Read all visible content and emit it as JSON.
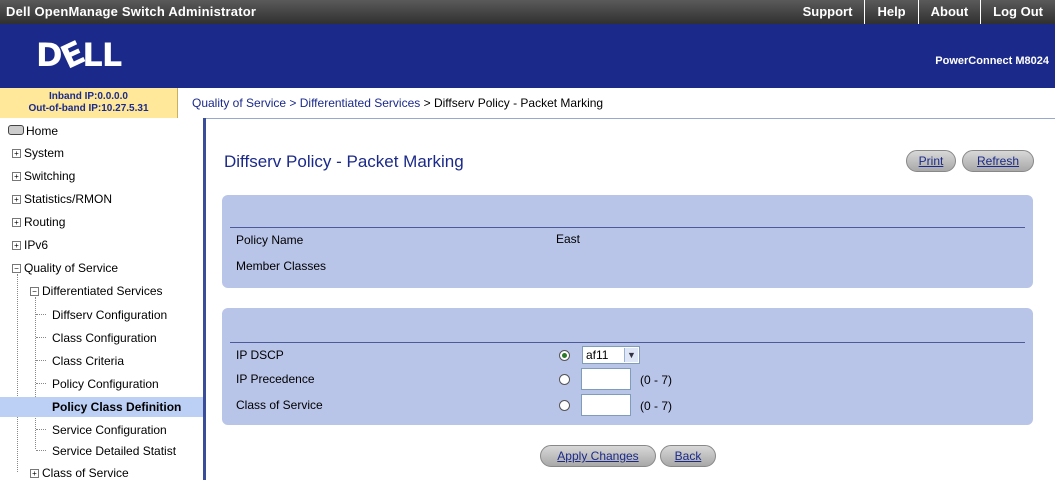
{
  "app": {
    "title": "Dell OpenManage Switch Administrator",
    "product": "PowerConnect M8024"
  },
  "topnav": [
    "Support",
    "Help",
    "About",
    "Log Out"
  ],
  "logo_text": "DELL",
  "ip": {
    "inband": "Inband IP:0.0.0.0",
    "oob": "Out-of-band IP:10.27.5.31"
  },
  "breadcrumb": {
    "parts": [
      "Quality of Service",
      "Differentiated Services",
      "Diffserv Policy - Packet Marking"
    ],
    "sep": " > "
  },
  "sidebar": {
    "home": "Home",
    "system": "System",
    "switching": "Switching",
    "stats": "Statistics/RMON",
    "routing": "Routing",
    "ipv6": "IPv6",
    "qos": "Quality of Service",
    "diffserv": "Differentiated Services",
    "diffserv_children": [
      "Diffserv Configuration",
      "Class Configuration",
      "Class Criteria",
      "Policy Configuration",
      "Policy Class Definition",
      "Service Configuration",
      "Service Detailed Statist"
    ],
    "cos": "Class of Service"
  },
  "page": {
    "title": "Diffserv Policy - Packet Marking",
    "print": "Print",
    "refresh": "Refresh",
    "policy_name_label": "Policy Name",
    "policy_name_value": "East",
    "member_classes_label": "Member Classes",
    "ip_dscp_label": "IP DSCP",
    "ip_dscp_selected": "af11",
    "ip_precedence_label": "IP Precedence",
    "cos_label": "Class of Service",
    "range_text": "(0 - 7)",
    "apply": "Apply Changes",
    "back": "Back"
  },
  "colors": {
    "brand": "#1b2a8a",
    "panel": "#b8c4e8",
    "ipbox": "#ffe89a",
    "selected": "#bcd0f5"
  }
}
